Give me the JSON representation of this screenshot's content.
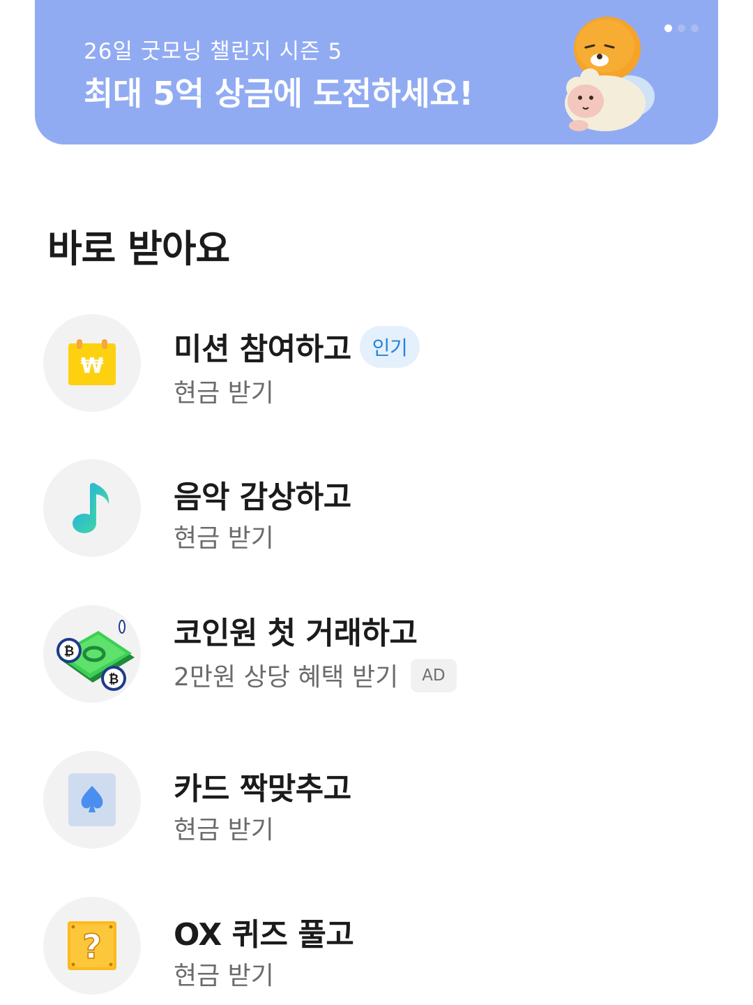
{
  "banner": {
    "subtitle": "26일 굿모닝 챌린지 시즌 5",
    "title": "최대 5억 상금에 도전하세요!",
    "page_indicator": {
      "current": 1,
      "total": 3
    }
  },
  "section": {
    "title": "바로 받아요"
  },
  "rewards": [
    {
      "title": "미션 참여하고",
      "subtitle": "현금 받기",
      "badge": "인기",
      "icon": "calendar-won-icon"
    },
    {
      "title": "음악 감상하고",
      "subtitle": "현금 받기",
      "icon": "music-note-icon"
    },
    {
      "title": "코인원 첫 거래하고",
      "subtitle": "2만원 상당 혜택 받기",
      "badge": "AD",
      "icon": "coin-cash-icon"
    },
    {
      "title": "카드 짝맞추고",
      "subtitle": "현금 받기",
      "icon": "spade-card-icon"
    },
    {
      "title": "OX 퀴즈 풀고",
      "subtitle": "현금 받기",
      "icon": "question-block-icon"
    }
  ],
  "colors": {
    "banner_bg": "#91abf3",
    "popular_badge_text": "#2483d8",
    "popular_badge_bg": "#e4f0fb",
    "icon_circle_bg": "#f2f2f2"
  }
}
